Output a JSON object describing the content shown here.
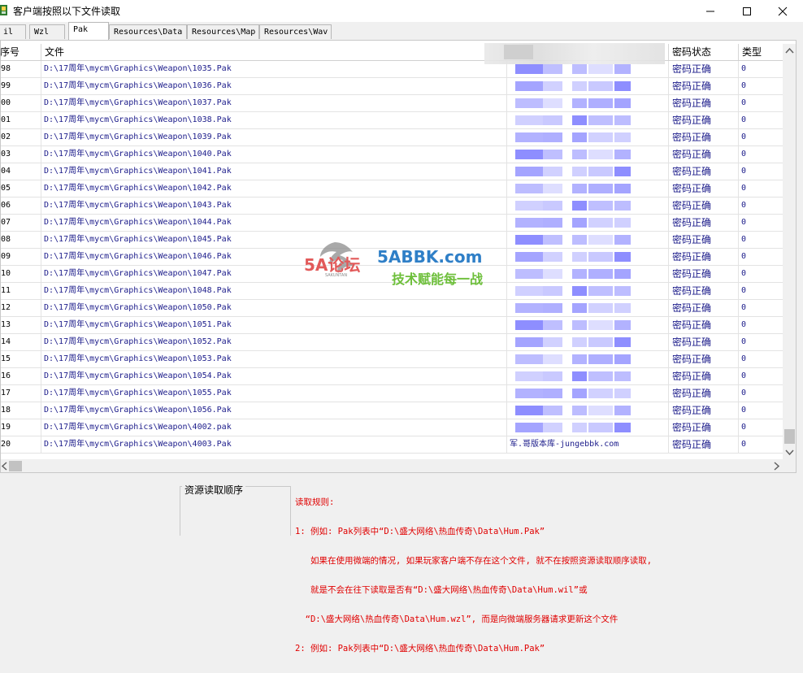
{
  "window": {
    "title": "客户端按照以下文件读取",
    "controls": {
      "minimize": "—",
      "maximize": "☐",
      "close": "✕"
    }
  },
  "tabs": [
    {
      "label": "il",
      "active": false
    },
    {
      "label": "Wzl",
      "active": false
    },
    {
      "label": "Pak",
      "active": true
    },
    {
      "label": "Resources\\Data",
      "active": false
    },
    {
      "label": "Resources\\Map",
      "active": false
    },
    {
      "label": "Resources\\Wav",
      "active": false
    }
  ],
  "list": {
    "headers": {
      "no": "序号",
      "file": "文件",
      "status": "密码状态",
      "type": "类型"
    },
    "rows": [
      {
        "no": "98",
        "file": "D:\\17周年\\mycm\\Graphics\\Weapon\\1035.Pak",
        "extra": "",
        "status": "密码正确",
        "type": "0"
      },
      {
        "no": "99",
        "file": "D:\\17周年\\mycm\\Graphics\\Weapon\\1036.Pak",
        "extra": "",
        "status": "密码正确",
        "type": "0"
      },
      {
        "no": "00",
        "file": "D:\\17周年\\mycm\\Graphics\\Weapon\\1037.Pak",
        "extra": "",
        "status": "密码正确",
        "type": "0"
      },
      {
        "no": "01",
        "file": "D:\\17周年\\mycm\\Graphics\\Weapon\\1038.Pak",
        "extra": "",
        "status": "密码正确",
        "type": "0"
      },
      {
        "no": "02",
        "file": "D:\\17周年\\mycm\\Graphics\\Weapon\\1039.Pak",
        "extra": "",
        "status": "密码正确",
        "type": "0"
      },
      {
        "no": "03",
        "file": "D:\\17周年\\mycm\\Graphics\\Weapon\\1040.Pak",
        "extra": "",
        "status": "密码正确",
        "type": "0"
      },
      {
        "no": "04",
        "file": "D:\\17周年\\mycm\\Graphics\\Weapon\\1041.Pak",
        "extra": "",
        "status": "密码正确",
        "type": "0"
      },
      {
        "no": "05",
        "file": "D:\\17周年\\mycm\\Graphics\\Weapon\\1042.Pak",
        "extra": "",
        "status": "密码正确",
        "type": "0"
      },
      {
        "no": "06",
        "file": "D:\\17周年\\mycm\\Graphics\\Weapon\\1043.Pak",
        "extra": "",
        "status": "密码正确",
        "type": "0"
      },
      {
        "no": "07",
        "file": "D:\\17周年\\mycm\\Graphics\\Weapon\\1044.Pak",
        "extra": "",
        "status": "密码正确",
        "type": "0"
      },
      {
        "no": "08",
        "file": "D:\\17周年\\mycm\\Graphics\\Weapon\\1045.Pak",
        "extra": "",
        "status": "密码正确",
        "type": "0"
      },
      {
        "no": "09",
        "file": "D:\\17周年\\mycm\\Graphics\\Weapon\\1046.Pak",
        "extra": "",
        "status": "密码正确",
        "type": "0"
      },
      {
        "no": "10",
        "file": "D:\\17周年\\mycm\\Graphics\\Weapon\\1047.Pak",
        "extra": "",
        "status": "密码正确",
        "type": "0"
      },
      {
        "no": "11",
        "file": "D:\\17周年\\mycm\\Graphics\\Weapon\\1048.Pak",
        "extra": "",
        "status": "密码正确",
        "type": "0"
      },
      {
        "no": "12",
        "file": "D:\\17周年\\mycm\\Graphics\\Weapon\\1050.Pak",
        "extra": "",
        "status": "密码正确",
        "type": "0"
      },
      {
        "no": "13",
        "file": "D:\\17周年\\mycm\\Graphics\\Weapon\\1051.Pak",
        "extra": "",
        "status": "密码正确",
        "type": "0"
      },
      {
        "no": "14",
        "file": "D:\\17周年\\mycm\\Graphics\\Weapon\\1052.Pak",
        "extra": "",
        "status": "密码正确",
        "type": "0"
      },
      {
        "no": "15",
        "file": "D:\\17周年\\mycm\\Graphics\\Weapon\\1053.Pak",
        "extra": "",
        "status": "密码正确",
        "type": "0"
      },
      {
        "no": "16",
        "file": "D:\\17周年\\mycm\\Graphics\\Weapon\\1054.Pak",
        "extra": "",
        "status": "密码正确",
        "type": "0"
      },
      {
        "no": "17",
        "file": "D:\\17周年\\mycm\\Graphics\\Weapon\\1055.Pak",
        "extra": "",
        "status": "密码正确",
        "type": "0"
      },
      {
        "no": "18",
        "file": "D:\\17周年\\mycm\\Graphics\\Weapon\\1056.Pak",
        "extra": "",
        "status": "密码正确",
        "type": "0"
      },
      {
        "no": "19",
        "file": "D:\\17周年\\mycm\\Graphics\\Weapon\\4002.pak",
        "extra": "",
        "status": "密码正确",
        "type": "0"
      },
      {
        "no": "20",
        "file": "D:\\17周年\\mycm\\Graphics\\Weapon\\4003.Pak",
        "extra": "军.哥版本库-jungebbk.com",
        "status": "密码正确",
        "type": "0"
      }
    ]
  },
  "bottom": {
    "group_title": "资源读取顺序",
    "rules": [
      "读取规则:",
      "1: 例如: Pak列表中“D:\\盛大网络\\热血传奇\\Data\\Hum.Pak”",
      "   如果在使用微端的情况, 如果玩家客户端不存在这个文件, 就不在按照资源读取顺序读取,",
      "   就是不会在往下读取是否有“D:\\盛大网络\\热血传奇\\Data\\Hum.wil”或",
      "  “D:\\盛大网络\\热血传奇\\Data\\Hum.wzl”, 而是向微端服务器请求更新这个文件",
      "2: 例如: Pak列表中“D:\\盛大网络\\热血传奇\\Data\\Hum.Pak”"
    ]
  },
  "watermark": {
    "brand": "5A论坛",
    "site": "5ABBK.com",
    "slogan": "技术赋能每一战",
    "sub": "SAKUNTAN"
  },
  "colors": {
    "link_blue": "#1b1b8a",
    "rules_red": "#e00000",
    "blur_purple": "#6e6ef0"
  }
}
